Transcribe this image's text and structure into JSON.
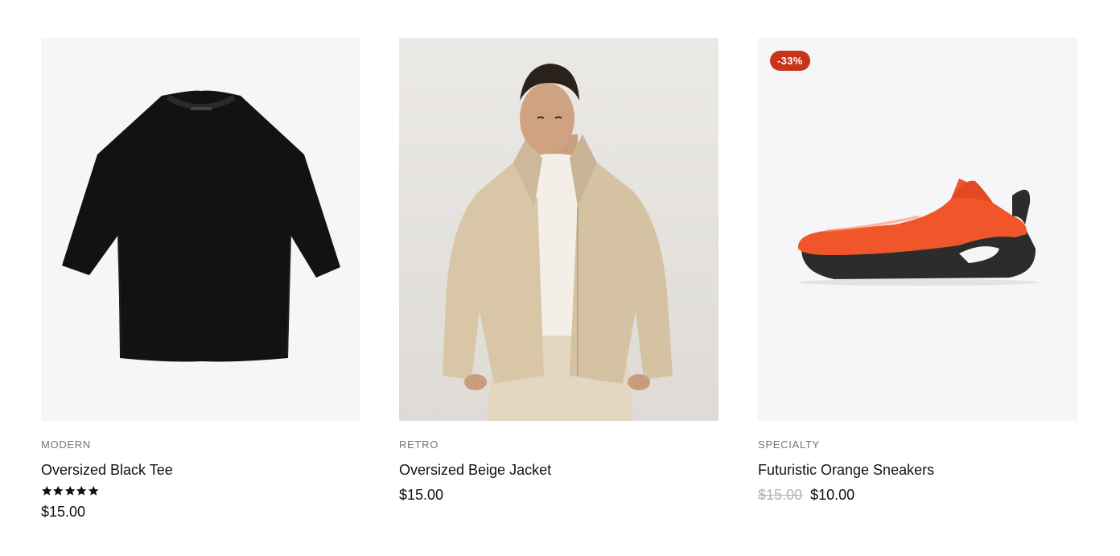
{
  "products": [
    {
      "category": "MODERN",
      "title": "Oversized Black Tee",
      "image": "black-tshirt",
      "rating": 5,
      "price": "$15.00"
    },
    {
      "category": "RETRO",
      "title": "Oversized Beige Jacket",
      "image": "model-beige-jacket",
      "price": "$15.00"
    },
    {
      "category": "SPECIALTY",
      "title": "Futuristic Orange Sneakers",
      "image": "orange-sneaker",
      "badge": "-33%",
      "price_old": "$15.00",
      "price": "$10.00"
    }
  ],
  "colors": {
    "badge": "#c8341a",
    "image_bg": "#f6f6f8",
    "category_text": "#767676",
    "old_price_text": "#b3b3b3",
    "accent_orange": "#f0562a"
  }
}
